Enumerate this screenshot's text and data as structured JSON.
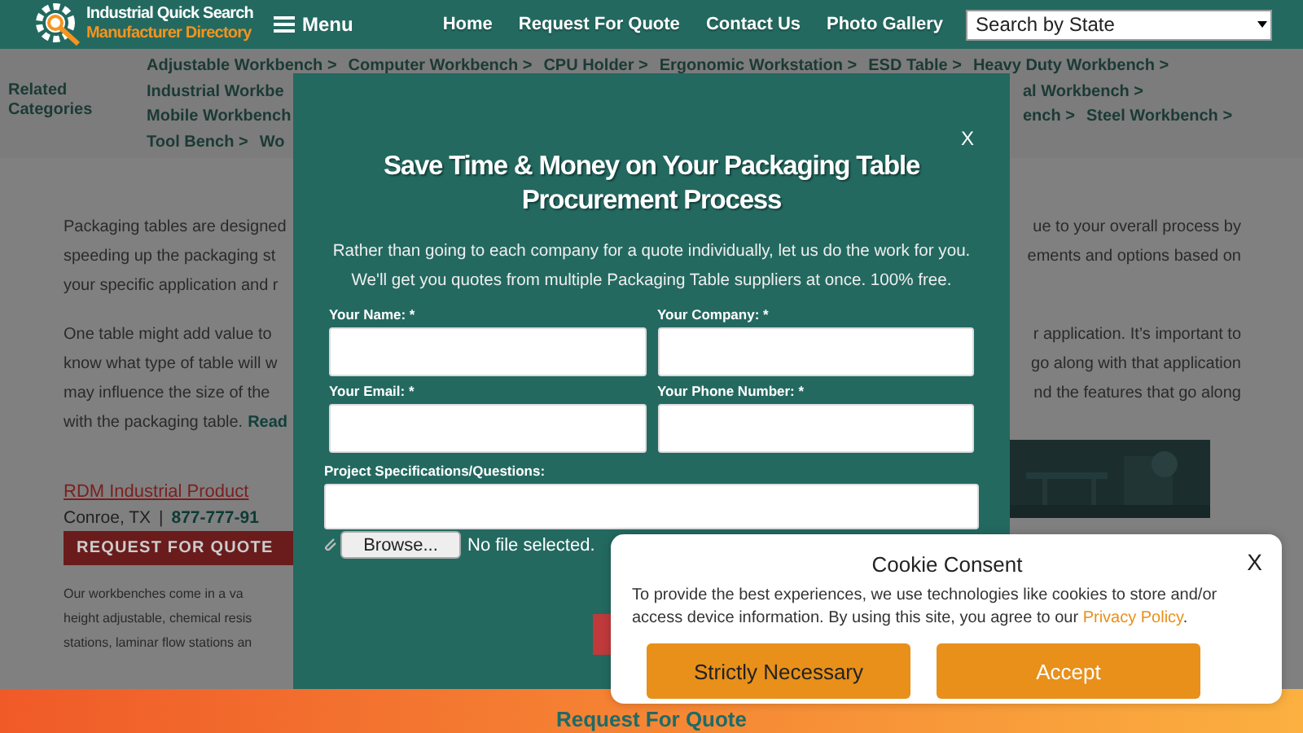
{
  "header": {
    "logo_line1": "Industrial Quick Search",
    "logo_line2": "Manufacturer Directory",
    "menu_label": "Menu",
    "nav": [
      "Home",
      "Request For Quote",
      "Contact Us",
      "Photo Gallery"
    ],
    "state_select": {
      "value": "Search by State"
    }
  },
  "categories": {
    "label": "Related Categories",
    "rows": [
      {
        "left": [
          "Adjustable Workbench >",
          "Computer Workbench >",
          "CPU Holder >",
          "Ergonomic Workstation >",
          "ESD Table >",
          "Heavy Duty Workbench >"
        ]
      },
      {
        "left": [
          "Industrial Workbe"
        ],
        "right": [
          "al Workbench >"
        ]
      },
      {
        "left": [
          "Mobile Workbench"
        ],
        "right": [
          "ench >",
          "Steel Workbench >"
        ]
      },
      {
        "left": [
          "Tool Bench >",
          "Wo"
        ]
      }
    ]
  },
  "paragraphs": [
    {
      "lines": [
        {
          "left": "Packaging tables are designed",
          "right": "ue to your overall process by"
        },
        {
          "left": "speeding up the packaging st",
          "right": "ements and options based on"
        },
        {
          "left": "your specific application and r"
        }
      ]
    },
    {
      "lines": [
        {
          "left": "One table might add value to",
          "right": "r application. It’s important to"
        },
        {
          "left": "know what type of table will w",
          "right": "go along with that application"
        },
        {
          "left": "may influence the size of the",
          "right": "nd the features that go along"
        },
        {
          "left": "with the packaging table.",
          "link": "Read"
        }
      ]
    }
  ],
  "listing": {
    "company": "RDM Industrial Product",
    "location": "Conroe, TX",
    "separator": "|",
    "phone": "877-777-91",
    "button": "REQUEST FOR QUOTE",
    "description": [
      "Our workbenches come in a va",
      "height adjustable, chemical resis",
      "stations, laminar flow stations an"
    ],
    "image": {
      "kind": "picture"
    }
  },
  "modal": {
    "close": "X",
    "title": [
      "Save Time & Money on Your Packaging Table",
      "Procurement Process"
    ],
    "intro": "Rather than going to each company for a quote individually, let us do the work for you. We'll get you quotes from multiple Packaging Table suppliers at once. 100% free.",
    "fields": [
      {
        "label": "Your Name: *"
      },
      {
        "label": "Your Company: *"
      },
      {
        "label": "Your Email: *"
      },
      {
        "label": "Your Phone Number: *"
      }
    ],
    "spec_label": "Project Specifications/Questions:",
    "browse": "Browse...",
    "file_status": "No file selected."
  },
  "cookie": {
    "title": "Cookie Consent",
    "close": "X",
    "text": "To provide the best experiences, we use technologies like cookies to store and/or access device information. By using this site, you agree to our",
    "link": "Privacy Policy",
    "after_link": ".",
    "buttons": [
      {
        "label": "Strictly Necessary",
        "kind": "necessary"
      },
      {
        "label": "Accept",
        "kind": "accept"
      }
    ]
  },
  "bottom_bar": {
    "label": "Request For Quote"
  }
}
